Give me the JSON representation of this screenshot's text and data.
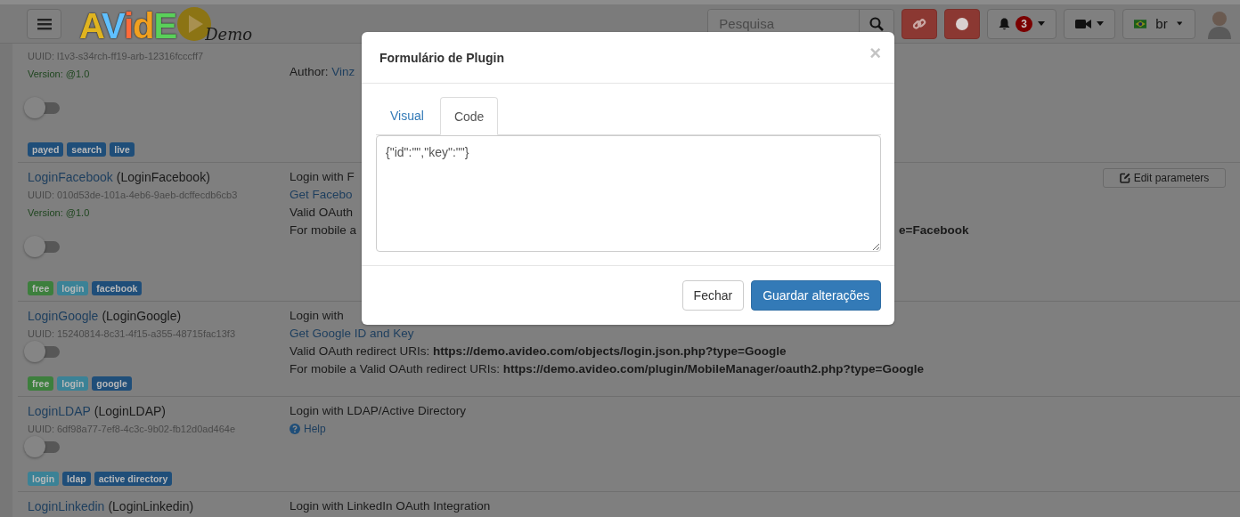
{
  "navbar": {
    "logo": {
      "letters": "AVidE",
      "tag": "Demo"
    },
    "search": {
      "placeholder": "Pesquisa"
    },
    "notifications": {
      "count": "3"
    },
    "language": {
      "label": "br"
    }
  },
  "plugins": [
    {
      "uuid": "UUID: l1v3-s34rch-ff19-arb-12316fcccff7",
      "version": "Version: @1.0",
      "on": false,
      "tags": [
        {
          "label": "payed",
          "color": "#1f4e79"
        },
        {
          "label": "search",
          "color": "#1f4e79"
        },
        {
          "label": "live",
          "color": "#1f4e79"
        }
      ],
      "lines": [
        {
          "kind": "author",
          "text": "Author: ",
          "link": "Vinz"
        }
      ]
    },
    {
      "name": "LoginFacebook",
      "id": "(LoginFacebook)",
      "uuid": "UUID: 010d53de-101a-4eb6-9aeb-dcffecdb6cb3",
      "version": "Version: @1.0",
      "on": false,
      "tags": [
        {
          "label": "free",
          "color": "#3d7f3d"
        },
        {
          "label": "login",
          "color": "#3b8296"
        },
        {
          "label": "facebook",
          "color": "#1f4e79"
        }
      ],
      "lines": [
        {
          "kind": "text",
          "text": "Login with F"
        },
        {
          "kind": "link",
          "text": "Get Facebo"
        },
        {
          "kind": "text",
          "text": "Valid OAuth"
        },
        {
          "kind": "text",
          "text": "For mobile a",
          "tail": "e=Facebook"
        }
      ],
      "edit": "Edit parameters"
    },
    {
      "name": "LoginGoogle",
      "id": "(LoginGoogle)",
      "uuid": "UUID: 15240814-8c31-4f15-a355-48715fac13f3",
      "on": false,
      "tags": [
        {
          "label": "free",
          "color": "#3d7f3d"
        },
        {
          "label": "login",
          "color": "#3b8296"
        },
        {
          "label": "google",
          "color": "#1f4e79"
        }
      ],
      "lines": [
        {
          "kind": "text",
          "text": "Login with"
        },
        {
          "kind": "link",
          "text": "Get Google ID and Key"
        },
        {
          "kind": "text",
          "text": "Valid OAuth redirect URIs: **https://demo.avideo.com/objects/login.json.php?type=Google**"
        },
        {
          "kind": "text",
          "text": "For mobile a Valid OAuth redirect URIs: **https://demo.avideo.com/plugin/MobileManager/oauth2.php?type=Google**"
        }
      ]
    },
    {
      "name": "LoginLDAP",
      "id": "(LoginLDAP)",
      "uuid": "UUID: 6df98a77-7ef8-4c3c-9b02-fb12d0ad464e",
      "on": false,
      "tags": [
        {
          "label": "login",
          "color": "#3b8296"
        },
        {
          "label": "ldap",
          "color": "#1f4e79"
        },
        {
          "label": "active directory",
          "color": "#1f4e79"
        }
      ],
      "lines": [
        {
          "kind": "text",
          "text": "Login with LDAP/Active Directory"
        },
        {
          "kind": "help",
          "text": "Help"
        }
      ]
    },
    {
      "name": "LoginLinkedin",
      "id": "(LoginLinkedin)",
      "lines": [
        {
          "kind": "text",
          "text": "Login with LinkedIn OAuth Integration"
        }
      ]
    }
  ],
  "modal": {
    "title": "Formulário de Plugin",
    "close": "×",
    "tabs": [
      {
        "label": "Visual",
        "selected": false
      },
      {
        "label": "Code",
        "selected": true
      }
    ],
    "code": "{\"id\":\"\",\"key\":\"\"}",
    "buttons": [
      {
        "label": "Fechar",
        "kind": "default"
      },
      {
        "label": "Guardar alterações",
        "kind": "primary"
      }
    ]
  }
}
